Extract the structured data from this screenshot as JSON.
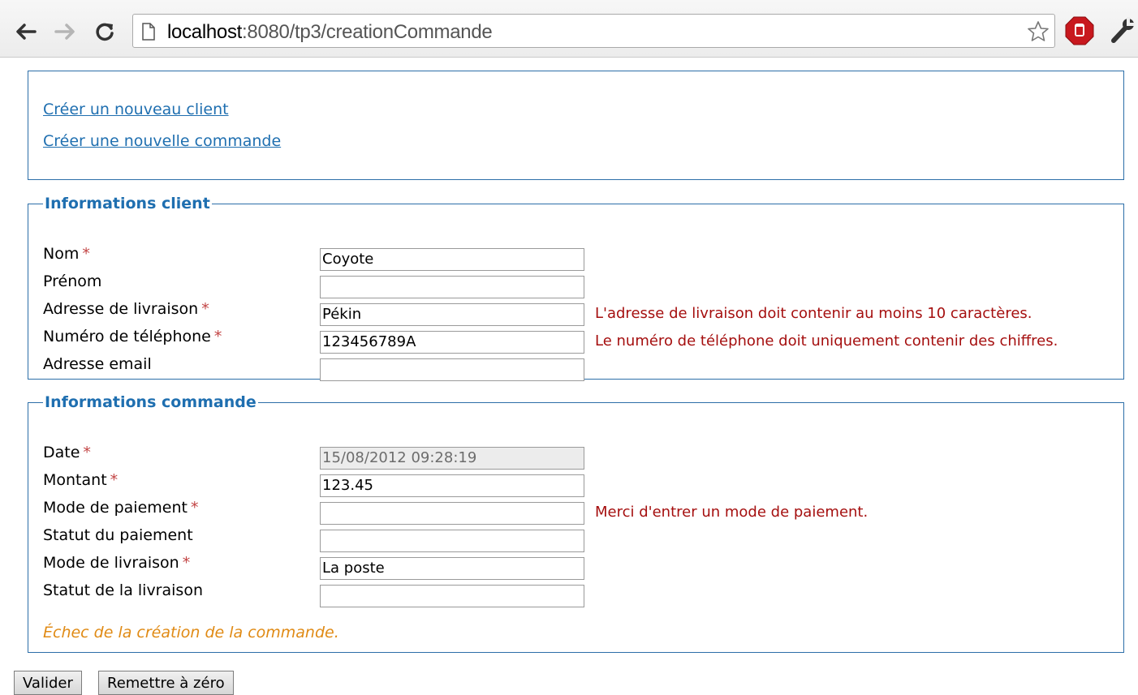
{
  "browser": {
    "url_host": "localhost",
    "url_rest": ":8080/tp3/creationCommande"
  },
  "menu": {
    "links": [
      "Créer un nouveau client",
      "Créer une nouvelle commande"
    ]
  },
  "client": {
    "legend": "Informations client",
    "fields": [
      {
        "label": "Nom",
        "required": "*",
        "value": "Coyote",
        "error": ""
      },
      {
        "label": "Prénom",
        "required": "",
        "value": "",
        "error": ""
      },
      {
        "label": "Adresse de livraison",
        "required": "*",
        "value": "Pékin",
        "error": "L'adresse de livraison doit contenir au moins 10 caractères."
      },
      {
        "label": "Numéro de téléphone",
        "required": "*",
        "value": "123456789A",
        "error": "Le numéro de téléphone doit uniquement contenir des chiffres."
      },
      {
        "label": "Adresse email",
        "required": "",
        "value": "",
        "error": ""
      }
    ]
  },
  "commande": {
    "legend": "Informations commande",
    "fields": [
      {
        "label": "Date",
        "required": "*",
        "value": "15/08/2012 09:28:19",
        "error": ""
      },
      {
        "label": "Montant",
        "required": "*",
        "value": "123.45",
        "error": ""
      },
      {
        "label": "Mode de paiement",
        "required": "*",
        "value": "",
        "error": "Merci d'entrer un mode de paiement."
      },
      {
        "label": "Statut du paiement",
        "required": "",
        "value": "",
        "error": ""
      },
      {
        "label": "Mode de livraison",
        "required": "*",
        "value": "La poste",
        "error": ""
      },
      {
        "label": "Statut de la livraison",
        "required": "",
        "value": "",
        "error": ""
      }
    ],
    "result": "Échec de la création de la commande."
  },
  "buttons": {
    "submit": "Valider",
    "reset": "Remettre à zéro"
  },
  "colors": {
    "accent": "#1f6fb0",
    "error": "#a50f0f",
    "required": "#c24444",
    "failure": "#e08a14"
  }
}
